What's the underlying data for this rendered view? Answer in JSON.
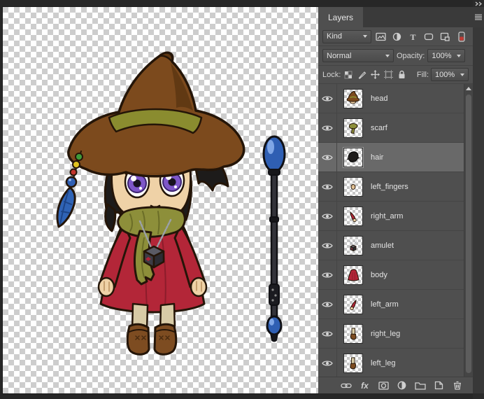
{
  "panel": {
    "tab_label": "Layers",
    "filter_row": {
      "kind_label": "Kind",
      "type_icon_label": "T",
      "icons": [
        "pixel-layers-filter",
        "adjustment-layers-filter",
        "type-layers-filter",
        "shape-layers-filter",
        "smart-objects-filter",
        "filtering-toggle"
      ]
    },
    "blend_row": {
      "blend_mode": "Normal",
      "opacity_label": "Opacity:",
      "opacity_value": "100%"
    },
    "lock_row": {
      "lock_label": "Lock:",
      "icons": [
        "lock-transparent-pixels",
        "lock-image-pixels",
        "lock-position",
        "lock-artboard-nesting",
        "lock-all"
      ],
      "fill_label": "Fill:",
      "fill_value": "100%"
    },
    "layers": {
      "selected": "hair",
      "items": [
        {
          "name": "head"
        },
        {
          "name": "scarf"
        },
        {
          "name": "hair"
        },
        {
          "name": "left_fingers"
        },
        {
          "name": "right_arm"
        },
        {
          "name": "amulet"
        },
        {
          "name": "body"
        },
        {
          "name": "left_arm"
        },
        {
          "name": "right_leg"
        },
        {
          "name": "left_leg"
        }
      ]
    },
    "bottom_bar": {
      "fx_label": "fx",
      "icons": [
        "link-layers",
        "layer-effects",
        "add-layer-mask",
        "new-adjustment-layer",
        "new-group",
        "new-layer",
        "delete-layer"
      ]
    },
    "chrome": {
      "collapse_icon": "collapse-to-icons",
      "menu_icon": "panel-menu"
    }
  },
  "canvas": {
    "contents": [
      "chibi-character",
      "magic-staff"
    ],
    "colors": {
      "checker_light": "#ffffff",
      "checker_dark": "#cdcdcd",
      "hat_brown": "#7c4a1d",
      "band_olive": "#8a8c2f",
      "dress_red": "#b32638",
      "scarf_olive": "#8d8f3a",
      "eye_purple": "#7e57c8",
      "orb_blue": "#2f5fb3",
      "skin": "#efd2a7"
    }
  },
  "ui_colors": {
    "panel_bg": "#4f4f4f",
    "panel_dark": "#3a3a3a",
    "selected_row": "#696969",
    "text": "#e3e3e3"
  }
}
